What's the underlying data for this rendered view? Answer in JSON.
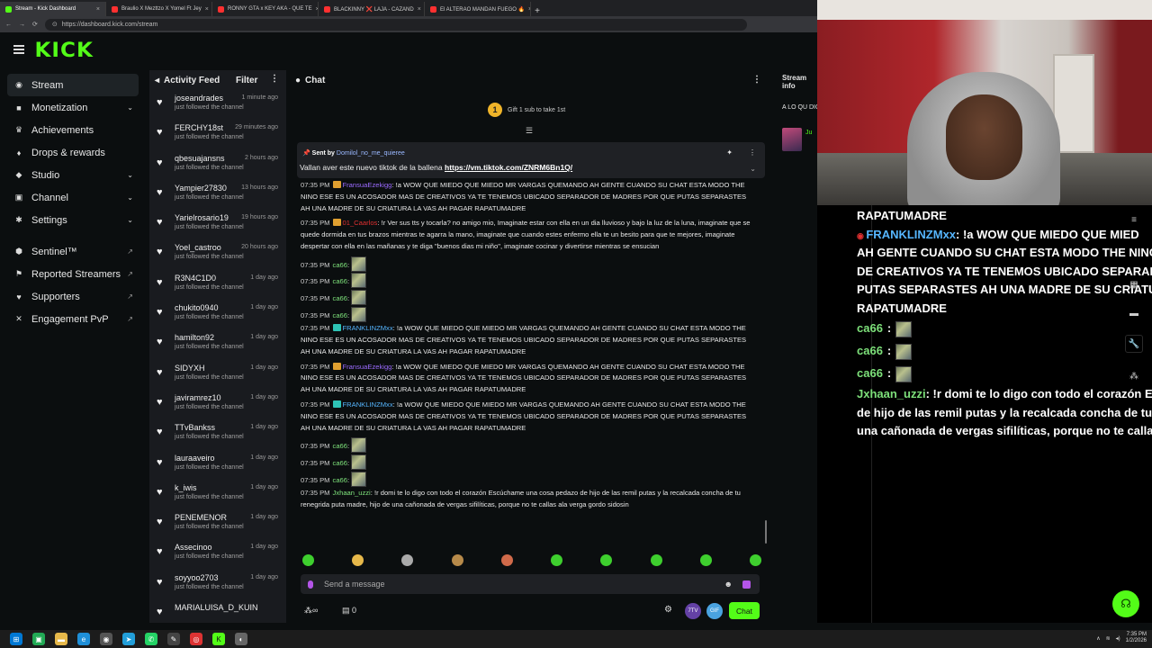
{
  "browser": {
    "tabs": [
      {
        "label": "Stream - Kick Dashboard",
        "active": true,
        "color": "#53fc18"
      },
      {
        "label": "Braulio X Mezttzo X Yomel Ft Jey",
        "active": false,
        "color": "#ff3030"
      },
      {
        "label": "RONNY GTA x KEY AKA - QUE TE",
        "active": false,
        "color": "#ff3030"
      },
      {
        "label": "BLACKINNY ❌ LAJA - CAZAND",
        "active": false,
        "color": "#ff3030"
      },
      {
        "label": "El ALTERAO MANDAN FUEGO 🔥",
        "active": false,
        "color": "#ff3030"
      }
    ],
    "url": "https://dashboard.kick.com/stream"
  },
  "brand": {
    "logo": "KICK",
    "accent": "#53fc18"
  },
  "sidebar": {
    "items": [
      {
        "label": "Stream",
        "icon": "broadcast-icon",
        "glyph": "◉",
        "active": true,
        "chevron": false,
        "external": false
      },
      {
        "label": "Monetization",
        "icon": "money-icon",
        "glyph": "■",
        "active": false,
        "chevron": true,
        "external": false
      },
      {
        "label": "Achievements",
        "icon": "trophy-icon",
        "glyph": "♛",
        "active": false,
        "chevron": false,
        "external": false
      },
      {
        "label": "Drops & rewards",
        "icon": "gift-icon",
        "glyph": "♦",
        "active": false,
        "chevron": false,
        "external": false
      },
      {
        "label": "Studio",
        "icon": "studio-icon",
        "glyph": "◆",
        "active": false,
        "chevron": true,
        "external": false
      },
      {
        "label": "Channel",
        "icon": "channel-icon",
        "glyph": "▣",
        "active": false,
        "chevron": true,
        "external": false
      },
      {
        "label": "Settings",
        "icon": "gear-icon",
        "glyph": "✱",
        "active": false,
        "chevron": true,
        "external": false
      },
      {
        "label": "Sentinel™",
        "icon": "shield-icon",
        "glyph": "⬢",
        "active": false,
        "chevron": false,
        "external": true
      },
      {
        "label": "Reported Streamers",
        "icon": "flag-icon",
        "glyph": "⚑",
        "active": false,
        "chevron": false,
        "external": true
      },
      {
        "label": "Supporters",
        "icon": "heart-icon",
        "glyph": "♥",
        "active": false,
        "chevron": false,
        "external": true
      },
      {
        "label": "Engagement PvP",
        "icon": "versus-icon",
        "glyph": "✕",
        "active": false,
        "chevron": false,
        "external": true
      }
    ]
  },
  "activity": {
    "title": "Activity Feed",
    "filter": "Filter",
    "items": [
      {
        "user": "joseandrades",
        "time": "1 minute ago",
        "action": "just followed the channel"
      },
      {
        "user": "FERCHY18st",
        "time": "29 minutes ago",
        "action": "just followed the channel"
      },
      {
        "user": "qbesuajansns",
        "time": "2 hours ago",
        "action": "just followed the channel"
      },
      {
        "user": "Yampier27830",
        "time": "13 hours ago",
        "action": "just followed the channel"
      },
      {
        "user": "Yarielrosario19",
        "time": "19 hours ago",
        "action": "just followed the channel"
      },
      {
        "user": "Yoel_castroo",
        "time": "20 hours ago",
        "action": "just followed the channel"
      },
      {
        "user": "R3N4C1D0",
        "time": "1 day ago",
        "action": "just followed the channel"
      },
      {
        "user": "chukito0940",
        "time": "1 day ago",
        "action": "just followed the channel"
      },
      {
        "user": "hamilton92",
        "time": "1 day ago",
        "action": "just followed the channel"
      },
      {
        "user": "SIDYXH",
        "time": "1 day ago",
        "action": "just followed the channel"
      },
      {
        "user": "javiramrez10",
        "time": "1 day ago",
        "action": "just followed the channel"
      },
      {
        "user": "TTvBankss",
        "time": "1 day ago",
        "action": "just followed the channel"
      },
      {
        "user": "lauraaveiro",
        "time": "1 day ago",
        "action": "just followed the channel"
      },
      {
        "user": "k_iwis",
        "time": "1 day ago",
        "action": "just followed the channel"
      },
      {
        "user": "PENEMENOR",
        "time": "1 day ago",
        "action": "just followed the channel"
      },
      {
        "user": "Assecinoo",
        "time": "1 day ago",
        "action": "just followed the channel"
      },
      {
        "user": "soyyoo2703",
        "time": "1 day ago",
        "action": "just followed the channel"
      },
      {
        "user": "MARIALUISA_D_KUIN",
        "time": "",
        "action": ""
      }
    ]
  },
  "chat": {
    "title": "Chat",
    "gift_text": "Gift 1 sub to take 1st",
    "pinned": {
      "sent_by_label": "Sent by",
      "sender": "Domilol_no_me_quieree",
      "message": "Vallan aver este nuevo tiktok de la ballena",
      "link": "https://vm.tiktok.com/ZNRM6Bn1Q/"
    },
    "messages": [
      {
        "time": "07:35 PM",
        "user": "FransuaEzekigg",
        "user_color": "#9b6bff",
        "badge": "#e0a030",
        "text": "!a WOW QUE MIEDO QUE MIEDO MR VARGAS QUEMANDO AH GENTE CUANDO SU CHAT ESTA MODO THE NINO ESE ES UN ACOSADOR MAS DE CREATIVOS YA TE TENEMOS UBICADO SEPARADOR DE MADRES POR QUE PUTAS SEPARASTES AH UNA MADRE DE SU CRIATURA LA VAS AH PAGAR RAPATUMADRE",
        "emote": false
      },
      {
        "time": "07:35 PM",
        "user": "01_Caarlos",
        "user_color": "#e03030",
        "badge": "#e0a030",
        "text": "!r Ver sus tts y tocarla? no amigo mio, Imaginate estar con ella en un dia lluvioso y bajo la luz de la luna, imaginate que se quede dormida en tus brazos mientras te agarra la mano, imaginate que cuando estes enfermo ella te un besito para que te mejores, imaginate despertar con ella en las mañanas y te diga \"buenos dias mi niño\", imaginate cocinar y divertirse mientras se ensucian",
        "emote": false
      },
      {
        "time": "07:35 PM",
        "user": "ca66",
        "user_color": "#7de07a",
        "badge": "",
        "text": "",
        "emote": true
      },
      {
        "time": "07:35 PM",
        "user": "ca66",
        "user_color": "#7de07a",
        "badge": "",
        "text": "",
        "emote": true
      },
      {
        "time": "07:35 PM",
        "user": "ca66",
        "user_color": "#7de07a",
        "badge": "",
        "text": "",
        "emote": true
      },
      {
        "time": "07:35 PM",
        "user": "ca66",
        "user_color": "#7de07a",
        "badge": "",
        "text": "",
        "emote": true
      },
      {
        "time": "07:35 PM",
        "user": "FRANKLINZMxx",
        "user_color": "#56b6ff",
        "badge": "#2ec4b6",
        "text": "!a WOW QUE MIEDO QUE MIEDO MR VARGAS QUEMANDO AH GENTE CUANDO SU CHAT ESTA MODO THE NINO ESE ES UN ACOSADOR MAS DE CREATIVOS YA TE TENEMOS UBICADO SEPARADOR DE MADRES POR QUE PUTAS SEPARASTES AH UNA MADRE DE SU CRIATURA LA VAS AH PAGAR RAPATUMADRE",
        "emote": false
      },
      {
        "time": "07:35 PM",
        "user": "FransuaEzekigg",
        "user_color": "#9b6bff",
        "badge": "#e0a030",
        "text": "!a WOW QUE MIEDO QUE MIEDO MR VARGAS QUEMANDO AH GENTE CUANDO SU CHAT ESTA MODO THE NINO ESE ES UN ACOSADOR MAS DE CREATIVOS YA TE TENEMOS UBICADO SEPARADOR DE MADRES POR QUE PUTAS SEPARASTES AH UNA MADRE DE SU CRIATURA LA VAS AH PAGAR RAPATUMADRE",
        "emote": false
      },
      {
        "time": "07:35 PM",
        "user": "FRANKLINZMxx",
        "user_color": "#56b6ff",
        "badge": "#2ec4b6",
        "text": "!a WOW QUE MIEDO QUE MIEDO MR VARGAS QUEMANDO AH GENTE CUANDO SU CHAT ESTA MODO THE NINO ESE ES UN ACOSADOR MAS DE CREATIVOS YA TE TENEMOS UBICADO SEPARADOR DE MADRES POR QUE PUTAS SEPARASTES AH UNA MADRE DE SU CRIATURA LA VAS AH PAGAR RAPATUMADRE",
        "emote": false
      },
      {
        "time": "07:35 PM",
        "user": "ca66",
        "user_color": "#7de07a",
        "badge": "",
        "text": "",
        "emote": true
      },
      {
        "time": "07:35 PM",
        "user": "ca66",
        "user_color": "#7de07a",
        "badge": "",
        "text": "",
        "emote": true
      },
      {
        "time": "07:35 PM",
        "user": "ca66",
        "user_color": "#7de07a",
        "badge": "",
        "text": "",
        "emote": true
      },
      {
        "time": "07:35 PM",
        "user": "Jxhaan_uzzi",
        "user_color": "#7de07a",
        "badge": "",
        "text": "!r domi te lo digo con todo el corazón Escúchame una cosa pedazo de hijo de las remil putas y la recalcada concha de tu renegrida puta madre, hijo de una cañonada de vergas sifilíticas, porque no te callas ala verga gordo sidosin",
        "emote": false
      }
    ],
    "input_placeholder": "Send a message",
    "gift_count": "0",
    "ttv_label": "7TV",
    "gif_label": "GIF",
    "send_label": "Chat"
  },
  "stream_info": {
    "title": "Stream info",
    "preview_text": "A LO QU DIGA (LL",
    "user_snippet": "Ju"
  },
  "overlay": {
    "lines": [
      {
        "type": "text",
        "user": "",
        "text": "RAPATUMADRE"
      },
      {
        "type": "text",
        "user": "FRANKLINZMxx",
        "text": ": !a WOW QUE MIEDO QUE MIED"
      },
      {
        "type": "text",
        "user": "",
        "text": "AH GENTE CUANDO SU CHAT ESTA MODO THE NINO"
      },
      {
        "type": "text",
        "user": "",
        "text": "DE CREATIVOS YA TE TENEMOS UBICADO SEPARADO"
      },
      {
        "type": "text",
        "user": "",
        "text": "PUTAS SEPARASTES AH UNA MADRE DE SU CRIATUR"
      },
      {
        "type": "text",
        "user": "",
        "text": "RAPATUMADRE"
      },
      {
        "type": "emote",
        "user": "ca66",
        "text": ":"
      },
      {
        "type": "emote",
        "user": "ca66",
        "text": ":"
      },
      {
        "type": "emote",
        "user": "ca66",
        "text": ":"
      },
      {
        "type": "text",
        "user": "Jxhaan_uzzi",
        "text": ": !r domi te lo digo con todo el corazón E"
      },
      {
        "type": "text",
        "user": "",
        "text": "de hijo de las remil putas y la recalcada concha de tu r"
      },
      {
        "type": "text",
        "user": "",
        "text": "una cañonada de vergas sifilíticas, porque no te callas"
      }
    ]
  },
  "taskbar": {
    "time": "7:35 PM",
    "date": "1/2/2026"
  }
}
